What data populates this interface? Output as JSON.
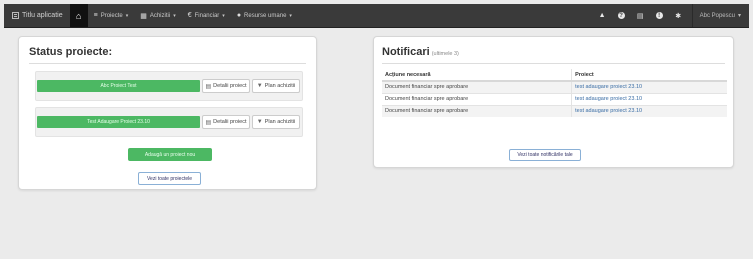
{
  "navbar": {
    "brand": "Titlu aplicatie",
    "home_icon": "⌂",
    "menus": [
      {
        "label": "Proiecte",
        "icon": "≡"
      },
      {
        "label": "Achizitii",
        "icon": "▦"
      },
      {
        "label": "Financiar",
        "icon": "€"
      },
      {
        "label": "Resurse umane",
        "icon": "●"
      }
    ],
    "caret": "▾",
    "right_icons": [
      "user-group-icon",
      "help-icon",
      "calendar-icon",
      "info-icon",
      "gear-icon"
    ],
    "right_glyphs": [
      "▲",
      "?",
      "▤",
      "!",
      "✱"
    ],
    "user": "Abc Popescu"
  },
  "status": {
    "title": "Status proiecte:",
    "projects": [
      {
        "name": "Abc Proiect Test",
        "details": "Detalii proiect",
        "plan": "Plan achizitii"
      },
      {
        "name": "Test Adaugare Proiect 23.10",
        "details": "Detalii proiect",
        "plan": "Plan achizitii"
      }
    ],
    "add_button": "Adaugă un proiect nou",
    "all_button": "Vezi toate proiectele"
  },
  "notifications": {
    "title": "Notificari",
    "subtitle": "(ultimele 3)",
    "columns": [
      "Acțiune necesară",
      "Proiect"
    ],
    "rows": [
      [
        "Document financiar spre aprobare",
        "test adaugare proiect 23.10"
      ],
      [
        "Document financiar spre aprobare",
        "test adaugare proiect 23.10"
      ],
      [
        "Document financiar spre aprobare",
        "test adaugare proiect 23.10"
      ]
    ],
    "all_button": "Vezi toate notificările tale"
  },
  "colors": {
    "navbar": "#3a3a3a",
    "success": "#4cb863",
    "link": "#3a6da5",
    "background": "#ebebeb"
  }
}
